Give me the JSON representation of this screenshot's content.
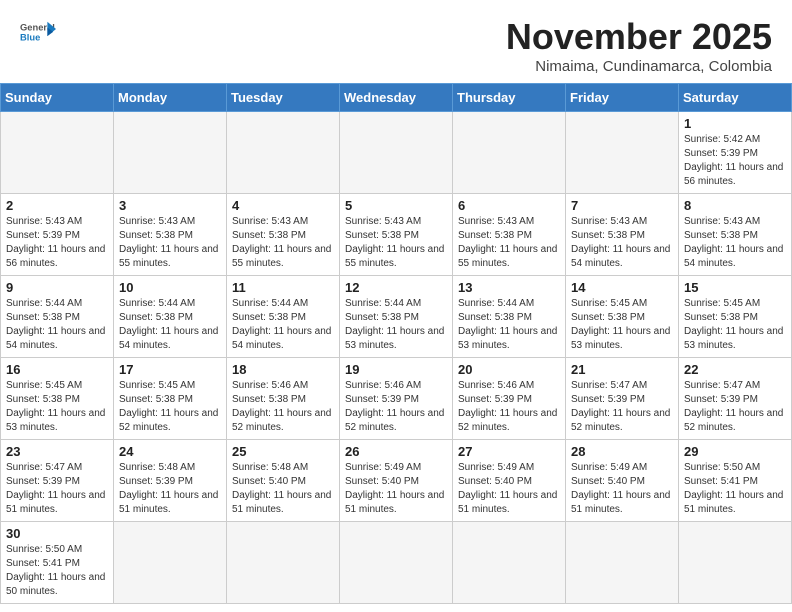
{
  "header": {
    "logo_general": "General",
    "logo_blue": "Blue",
    "month": "November 2025",
    "location": "Nimaima, Cundinamarca, Colombia"
  },
  "weekdays": [
    "Sunday",
    "Monday",
    "Tuesday",
    "Wednesday",
    "Thursday",
    "Friday",
    "Saturday"
  ],
  "weeks": [
    [
      {
        "day": "",
        "info": ""
      },
      {
        "day": "",
        "info": ""
      },
      {
        "day": "",
        "info": ""
      },
      {
        "day": "",
        "info": ""
      },
      {
        "day": "",
        "info": ""
      },
      {
        "day": "",
        "info": ""
      },
      {
        "day": "1",
        "info": "Sunrise: 5:42 AM\nSunset: 5:39 PM\nDaylight: 11 hours\nand 56 minutes."
      }
    ],
    [
      {
        "day": "2",
        "info": "Sunrise: 5:43 AM\nSunset: 5:39 PM\nDaylight: 11 hours\nand 56 minutes."
      },
      {
        "day": "3",
        "info": "Sunrise: 5:43 AM\nSunset: 5:38 PM\nDaylight: 11 hours\nand 55 minutes."
      },
      {
        "day": "4",
        "info": "Sunrise: 5:43 AM\nSunset: 5:38 PM\nDaylight: 11 hours\nand 55 minutes."
      },
      {
        "day": "5",
        "info": "Sunrise: 5:43 AM\nSunset: 5:38 PM\nDaylight: 11 hours\nand 55 minutes."
      },
      {
        "day": "6",
        "info": "Sunrise: 5:43 AM\nSunset: 5:38 PM\nDaylight: 11 hours\nand 55 minutes."
      },
      {
        "day": "7",
        "info": "Sunrise: 5:43 AM\nSunset: 5:38 PM\nDaylight: 11 hours\nand 54 minutes."
      },
      {
        "day": "8",
        "info": "Sunrise: 5:43 AM\nSunset: 5:38 PM\nDaylight: 11 hours\nand 54 minutes."
      }
    ],
    [
      {
        "day": "9",
        "info": "Sunrise: 5:44 AM\nSunset: 5:38 PM\nDaylight: 11 hours\nand 54 minutes."
      },
      {
        "day": "10",
        "info": "Sunrise: 5:44 AM\nSunset: 5:38 PM\nDaylight: 11 hours\nand 54 minutes."
      },
      {
        "day": "11",
        "info": "Sunrise: 5:44 AM\nSunset: 5:38 PM\nDaylight: 11 hours\nand 54 minutes."
      },
      {
        "day": "12",
        "info": "Sunrise: 5:44 AM\nSunset: 5:38 PM\nDaylight: 11 hours\nand 53 minutes."
      },
      {
        "day": "13",
        "info": "Sunrise: 5:44 AM\nSunset: 5:38 PM\nDaylight: 11 hours\nand 53 minutes."
      },
      {
        "day": "14",
        "info": "Sunrise: 5:45 AM\nSunset: 5:38 PM\nDaylight: 11 hours\nand 53 minutes."
      },
      {
        "day": "15",
        "info": "Sunrise: 5:45 AM\nSunset: 5:38 PM\nDaylight: 11 hours\nand 53 minutes."
      }
    ],
    [
      {
        "day": "16",
        "info": "Sunrise: 5:45 AM\nSunset: 5:38 PM\nDaylight: 11 hours\nand 53 minutes."
      },
      {
        "day": "17",
        "info": "Sunrise: 5:45 AM\nSunset: 5:38 PM\nDaylight: 11 hours\nand 52 minutes."
      },
      {
        "day": "18",
        "info": "Sunrise: 5:46 AM\nSunset: 5:38 PM\nDaylight: 11 hours\nand 52 minutes."
      },
      {
        "day": "19",
        "info": "Sunrise: 5:46 AM\nSunset: 5:39 PM\nDaylight: 11 hours\nand 52 minutes."
      },
      {
        "day": "20",
        "info": "Sunrise: 5:46 AM\nSunset: 5:39 PM\nDaylight: 11 hours\nand 52 minutes."
      },
      {
        "day": "21",
        "info": "Sunrise: 5:47 AM\nSunset: 5:39 PM\nDaylight: 11 hours\nand 52 minutes."
      },
      {
        "day": "22",
        "info": "Sunrise: 5:47 AM\nSunset: 5:39 PM\nDaylight: 11 hours\nand 52 minutes."
      }
    ],
    [
      {
        "day": "23",
        "info": "Sunrise: 5:47 AM\nSunset: 5:39 PM\nDaylight: 11 hours\nand 51 minutes."
      },
      {
        "day": "24",
        "info": "Sunrise: 5:48 AM\nSunset: 5:39 PM\nDaylight: 11 hours\nand 51 minutes."
      },
      {
        "day": "25",
        "info": "Sunrise: 5:48 AM\nSunset: 5:40 PM\nDaylight: 11 hours\nand 51 minutes."
      },
      {
        "day": "26",
        "info": "Sunrise: 5:49 AM\nSunset: 5:40 PM\nDaylight: 11 hours\nand 51 minutes."
      },
      {
        "day": "27",
        "info": "Sunrise: 5:49 AM\nSunset: 5:40 PM\nDaylight: 11 hours\nand 51 minutes."
      },
      {
        "day": "28",
        "info": "Sunrise: 5:49 AM\nSunset: 5:40 PM\nDaylight: 11 hours\nand 51 minutes."
      },
      {
        "day": "29",
        "info": "Sunrise: 5:50 AM\nSunset: 5:41 PM\nDaylight: 11 hours\nand 51 minutes."
      }
    ],
    [
      {
        "day": "30",
        "info": "Sunrise: 5:50 AM\nSunset: 5:41 PM\nDaylight: 11 hours\nand 50 minutes."
      },
      {
        "day": "",
        "info": ""
      },
      {
        "day": "",
        "info": ""
      },
      {
        "day": "",
        "info": ""
      },
      {
        "day": "",
        "info": ""
      },
      {
        "day": "",
        "info": ""
      },
      {
        "day": "",
        "info": ""
      }
    ]
  ]
}
